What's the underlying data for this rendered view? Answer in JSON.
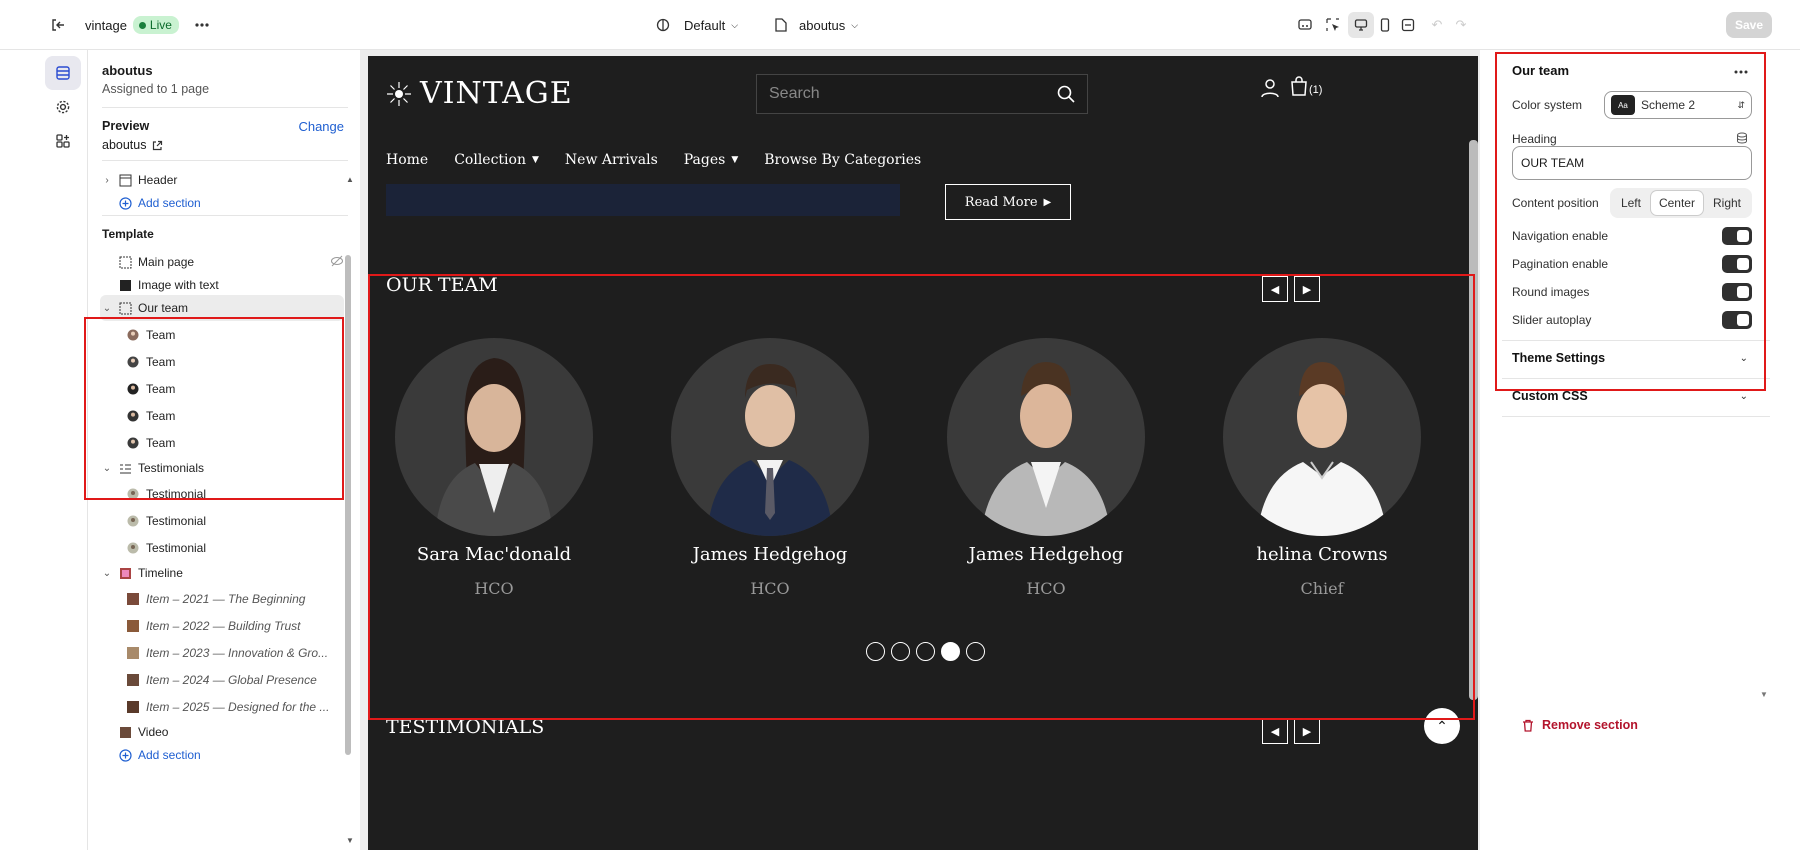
{
  "topbar": {
    "store_name": "vintage",
    "live_label": "Live",
    "theme_label": "Default",
    "page_label": "aboutus",
    "save_label": "Save"
  },
  "left_panel": {
    "page_title": "aboutus",
    "page_sub": "Assigned to 1 page",
    "preview_label": "Preview",
    "change_label": "Change",
    "preview_page": "aboutus",
    "header_label": "Header",
    "add_section_label": "Add section",
    "template_label": "Template",
    "main_page": "Main page",
    "image_with_text": "Image with text",
    "our_team": "Our team",
    "team_items": [
      "Team",
      "Team",
      "Team",
      "Team",
      "Team"
    ],
    "testimonials": "Testimonials",
    "testimonial_items": [
      "Testimonial",
      "Testimonial",
      "Testimonial"
    ],
    "timeline": "Timeline",
    "timeline_items": [
      "Item – 2021 — The Beginning",
      "Item – 2022 — Building Trust",
      "Item – 2023 — Innovation & Gro...",
      "Item – 2024 — Global Presence",
      "Item – 2025 — Designed for the ..."
    ],
    "video": "Video",
    "add_section_bottom": "Add section"
  },
  "store": {
    "logo": "VINTAGE",
    "search_placeholder": "Search",
    "cart_count": "(1)",
    "nav": [
      "Home",
      "Collection",
      "New Arrivals",
      "Pages",
      "Browse By Categories"
    ],
    "read_more": "Read More",
    "team_heading": "OUR TEAM",
    "members": [
      {
        "name": "Sara Mac'donald",
        "role": "HCO"
      },
      {
        "name": "James Hedgehog",
        "role": "HCO"
      },
      {
        "name": "James Hedgehog",
        "role": "HCO"
      },
      {
        "name": "helina Crowns",
        "role": "Chief"
      }
    ],
    "pagination_total": 5,
    "pagination_active": 4,
    "testimonials_heading": "TESTIMONIALS"
  },
  "right_panel": {
    "title": "Our team",
    "color_system_label": "Color system",
    "color_system_value": "Scheme 2",
    "scheme_badge": "Aa",
    "heading_label": "Heading",
    "heading_value": "OUR TEAM",
    "content_position_label": "Content position",
    "positions": [
      "Left",
      "Center",
      "Right"
    ],
    "position_selected": "Center",
    "navigation_label": "Navigation enable",
    "pagination_label": "Pagination enable",
    "round_images_label": "Round images",
    "autoplay_label": "Slider autoplay",
    "theme_settings": "Theme Settings",
    "custom_css": "Custom CSS",
    "remove_section": "Remove section"
  },
  "colors": {
    "accent_red": "#e01919",
    "link_blue": "#1f5fd1",
    "store_bg": "#1e1e1e"
  }
}
